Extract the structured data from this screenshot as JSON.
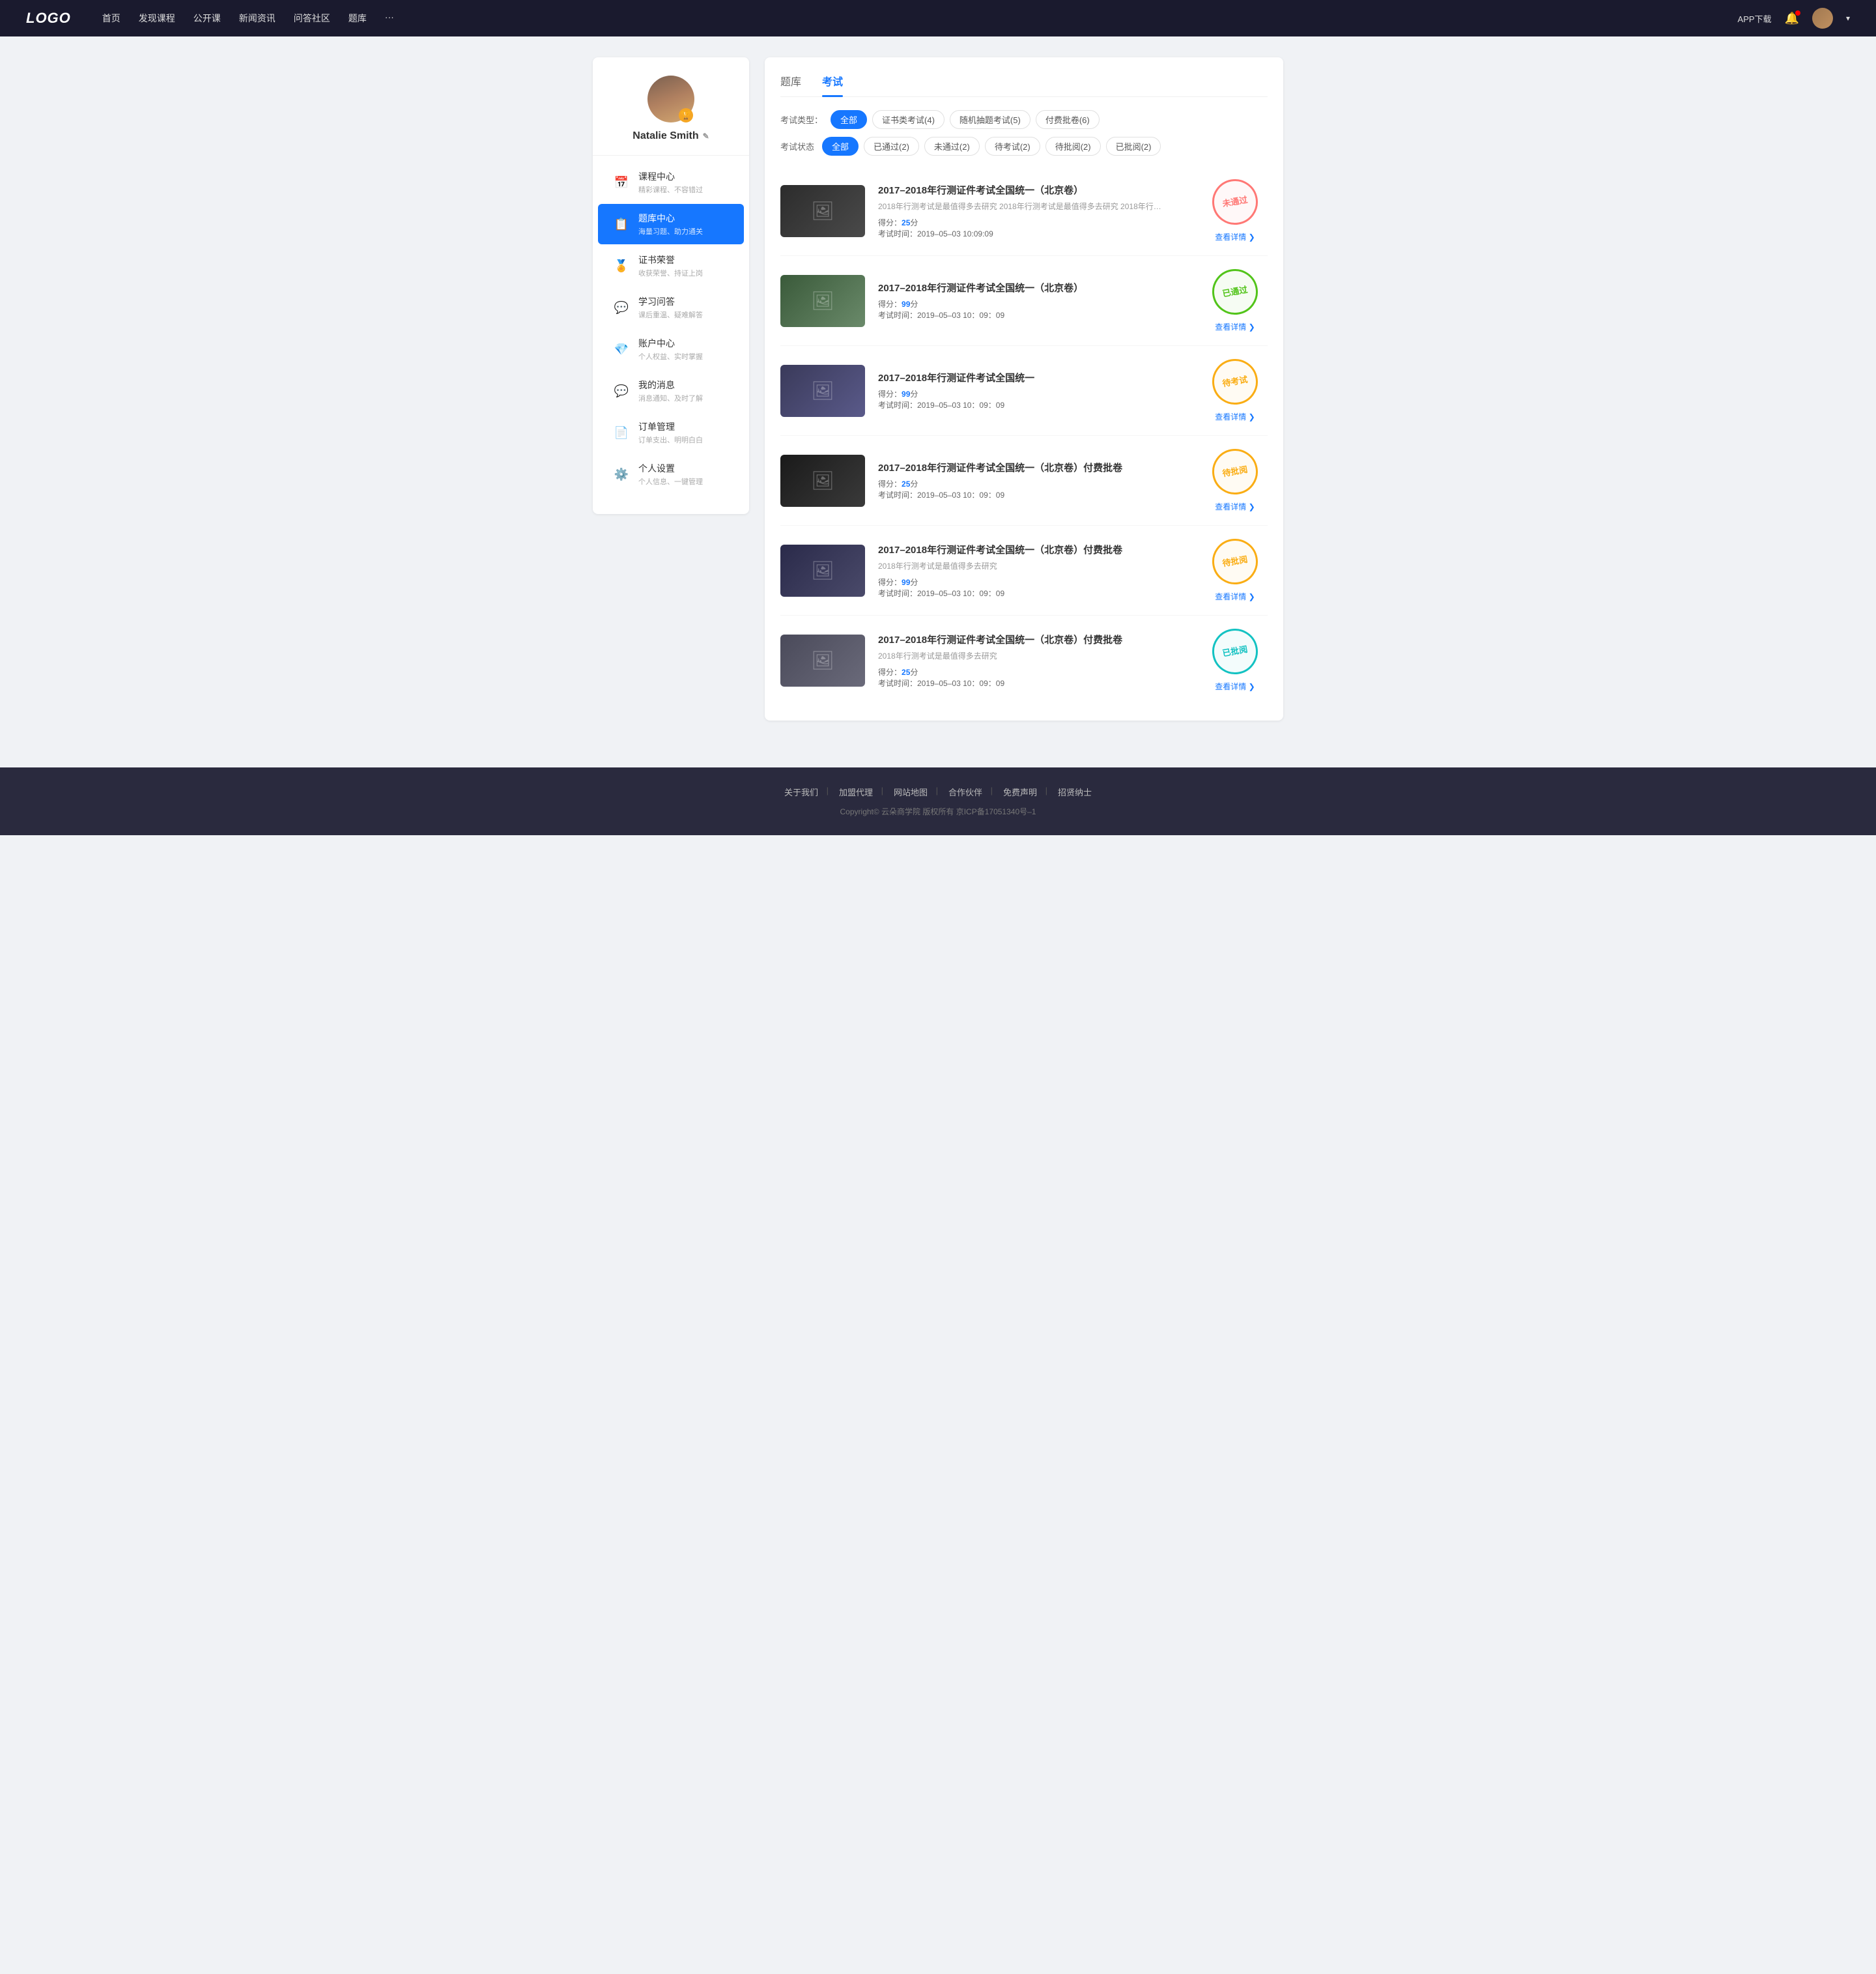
{
  "navbar": {
    "logo": "LOGO",
    "links": [
      "首页",
      "发现课程",
      "公开课",
      "新闻资讯",
      "问答社区",
      "题库",
      "···"
    ],
    "app_btn": "APP下载",
    "dropdown_label": "▾"
  },
  "sidebar": {
    "username": "Natalie Smith",
    "items": [
      {
        "id": "course-center",
        "icon": "📅",
        "title": "课程中心",
        "sub": "精彩课程、不容错过",
        "active": false
      },
      {
        "id": "exam-center",
        "icon": "📋",
        "title": "题库中心",
        "sub": "海量习题、助力通关",
        "active": true
      },
      {
        "id": "cert-honor",
        "icon": "🏅",
        "title": "证书荣誉",
        "sub": "收获荣誉、持证上岗",
        "active": false
      },
      {
        "id": "qa",
        "icon": "💬",
        "title": "学习问答",
        "sub": "课后重温、疑难解答",
        "active": false
      },
      {
        "id": "account",
        "icon": "💎",
        "title": "账户中心",
        "sub": "个人权益、实时掌握",
        "active": false
      },
      {
        "id": "messages",
        "icon": "💬",
        "title": "我的消息",
        "sub": "消息通知、及时了解",
        "active": false
      },
      {
        "id": "orders",
        "icon": "📄",
        "title": "订单管理",
        "sub": "订单支出、明明白白",
        "active": false
      },
      {
        "id": "settings",
        "icon": "⚙️",
        "title": "个人设置",
        "sub": "个人信息、一键管理",
        "active": false
      }
    ]
  },
  "content": {
    "tabs": [
      {
        "id": "question-bank",
        "label": "题库"
      },
      {
        "id": "exam",
        "label": "考试",
        "active": true
      }
    ],
    "filter_type": {
      "label": "考试类型：",
      "options": [
        {
          "label": "全部",
          "active": true
        },
        {
          "label": "证书类考试(4)",
          "active": false
        },
        {
          "label": "随机抽题考试(5)",
          "active": false
        },
        {
          "label": "付费批卷(6)",
          "active": false
        }
      ]
    },
    "filter_status": {
      "label": "考试状态",
      "options": [
        {
          "label": "全部",
          "active": true
        },
        {
          "label": "已通过(2)",
          "active": false
        },
        {
          "label": "未通过(2)",
          "active": false
        },
        {
          "label": "待考试(2)",
          "active": false
        },
        {
          "label": "待批阅(2)",
          "active": false
        },
        {
          "label": "已批阅(2)",
          "active": false
        }
      ]
    },
    "exams": [
      {
        "id": "exam-1",
        "thumb_class": "thumb-1",
        "title": "2017–2018年行测证件考试全国统一（北京卷）",
        "desc": "2018年行测考试是最值得多去研究 2018年行测考试是最值得多去研究 2018年行…",
        "score_label": "得分：",
        "score": "25",
        "score_unit": "分",
        "time_label": "考试时间：",
        "time": "2019–05–03  10:09:09",
        "stamp_text": "未通过",
        "stamp_class": "stamp-fail",
        "detail_label": "查看详情"
      },
      {
        "id": "exam-2",
        "thumb_class": "thumb-2",
        "title": "2017–2018年行测证件考试全国统一（北京卷）",
        "desc": "",
        "score_label": "得分：",
        "score": "99",
        "score_unit": "分",
        "time_label": "考试时间：",
        "time": "2019–05–03  10：09：09",
        "stamp_text": "已通过",
        "stamp_class": "stamp-pass",
        "detail_label": "查看详情"
      },
      {
        "id": "exam-3",
        "thumb_class": "thumb-3",
        "title": "2017–2018年行测证件考试全国统一",
        "desc": "",
        "score_label": "得分：",
        "score": "99",
        "score_unit": "分",
        "time_label": "考试时间：",
        "time": "2019–05–03  10：09：09",
        "stamp_text": "待考试",
        "stamp_class": "stamp-pending",
        "detail_label": "查看详情"
      },
      {
        "id": "exam-4",
        "thumb_class": "thumb-4",
        "title": "2017–2018年行测证件考试全国统一（北京卷）付费批卷",
        "desc": "",
        "score_label": "得分：",
        "score": "25",
        "score_unit": "分",
        "time_label": "考试时间：",
        "time": "2019–05–03  10：09：09",
        "stamp_text": "待批阅",
        "stamp_class": "stamp-pending2",
        "detail_label": "查看详情"
      },
      {
        "id": "exam-5",
        "thumb_class": "thumb-5",
        "title": "2017–2018年行测证件考试全国统一（北京卷）付费批卷",
        "desc": "2018年行测考试是最值得多去研究",
        "score_label": "得分：",
        "score": "99",
        "score_unit": "分",
        "time_label": "考试时间：",
        "time": "2019–05–03  10：09：09",
        "stamp_text": "待批阅",
        "stamp_class": "stamp-pending2",
        "detail_label": "查看详情"
      },
      {
        "id": "exam-6",
        "thumb_class": "thumb-6",
        "title": "2017–2018年行测证件考试全国统一（北京卷）付费批卷",
        "desc": "2018年行测考试是最值得多去研究",
        "score_label": "得分：",
        "score": "25",
        "score_unit": "分",
        "time_label": "考试时间：",
        "time": "2019–05–03  10：09：09",
        "stamp_text": "已批阅",
        "stamp_class": "stamp-reviewed",
        "detail_label": "查看详情"
      }
    ]
  },
  "footer": {
    "links": [
      "关于我们",
      "加盟代理",
      "网站地图",
      "合作伙伴",
      "免费声明",
      "招贤纳士"
    ],
    "copyright": "Copyright© 云朵商学院  版权所有    京ICP备17051340号–1"
  }
}
